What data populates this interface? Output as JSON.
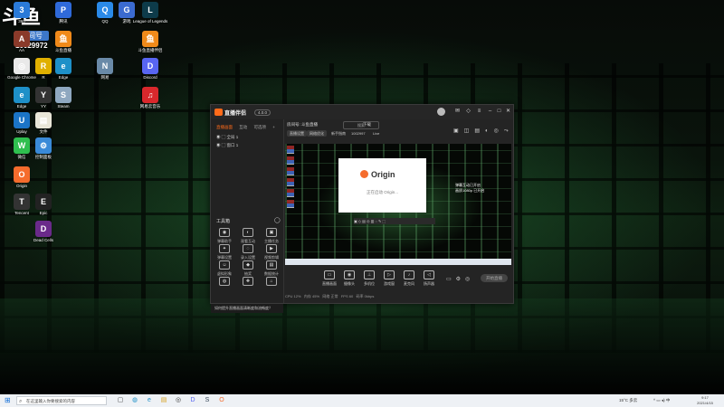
{
  "desktop": {
    "brand": "斗鱼",
    "douyu_badge": {
      "tag": "房间号",
      "number": "10029972"
    },
    "icons": [
      {
        "label": "360",
        "color": "#2a7ad8",
        "glyph": "3"
      },
      {
        "label": "腾讯",
        "color": "#2f6ad9",
        "glyph": "P"
      },
      {
        "label": "QQ",
        "color": "#2a8ae8",
        "glyph": "Q"
      },
      {
        "label": "游戏",
        "color": "#3b6bd0",
        "glyph": "G"
      },
      {
        "label": "League of Legends",
        "color": "#0d3b4a",
        "glyph": "L"
      },
      {
        "label": "AA",
        "color": "#8a3a2a",
        "glyph": "A"
      },
      {
        "label": "斗鱼直播",
        "color": "#f08a1a",
        "glyph": "鱼"
      },
      {
        "label": "Google Chrome",
        "color": "#e9e9e9",
        "glyph": "◎"
      },
      {
        "label": "Edge",
        "color": "#1e90c8",
        "glyph": "e"
      },
      {
        "label": "R",
        "color": "#e0b000",
        "glyph": "R"
      },
      {
        "label": "网易",
        "color": "#6a8aa8",
        "glyph": "N"
      },
      {
        "label": "斗鱼直播伴侣",
        "color": "#f08a1a",
        "glyph": "鱼"
      },
      {
        "label": "Discord",
        "color": "#5865f2",
        "glyph": "D"
      },
      {
        "label": "Edge",
        "color": "#1e90c8",
        "glyph": "e"
      },
      {
        "label": "Steam",
        "color": "#8fa8c0",
        "glyph": "S"
      },
      {
        "label": "YY",
        "color": "#333",
        "glyph": "Y"
      },
      {
        "label": "网易云音乐",
        "color": "#d9282c",
        "glyph": "♫"
      },
      {
        "label": "Uplay",
        "color": "#1b74c7",
        "glyph": "U"
      },
      {
        "label": "文件",
        "color": "#e9e6d8",
        "glyph": "▤"
      },
      {
        "label": "微信",
        "color": "#2fbf4f",
        "glyph": "W"
      },
      {
        "label": "控制面板",
        "color": "#3a8ad8",
        "glyph": "⚙"
      },
      {
        "label": "Origin",
        "color": "#f56c2d",
        "glyph": "O"
      },
      {
        "label": "Tencent",
        "color": "#333",
        "glyph": "T"
      },
      {
        "label": "Epic",
        "color": "#222",
        "glyph": "E"
      },
      {
        "label": "Dead Cells",
        "color": "#6a2a8a",
        "glyph": "D"
      }
    ]
  },
  "app": {
    "title": "直播伴侣",
    "version": "4.0.0",
    "tabs": [
      "直播画面",
      "互动",
      "可选项"
    ],
    "scenes": [
      "全局 1",
      "窗口 1"
    ],
    "tools_title": "工具箱",
    "tools": [
      {
        "label": "弹幕助手",
        "glyph": "◉"
      },
      {
        "label": "观看互动",
        "glyph": "◐"
      },
      {
        "label": "主播任务",
        "glyph": "▣"
      },
      {
        "label": "弹幕设置",
        "glyph": "✦"
      },
      {
        "label": "录入设置",
        "glyph": "◌"
      },
      {
        "label": "视频剪辑",
        "glyph": "▶"
      },
      {
        "label": "虚拟形象",
        "glyph": "☺"
      },
      {
        "label": "抽奖",
        "glyph": "◆"
      },
      {
        "label": "数据统计",
        "glyph": "▤"
      },
      {
        "label": "",
        "glyph": "◍"
      },
      {
        "label": "",
        "glyph": "✚"
      },
      {
        "label": "",
        "glyph": "⌂"
      }
    ],
    "notice": "如何提升直播画面清晰度和流畅度？",
    "top_row": {
      "left": "房间号: 斗鱼直播",
      "search": "搜索",
      "room_label": "下载"
    },
    "pills": [
      "直播设置",
      "网络优化",
      "新手指南",
      "1002997",
      "Live"
    ],
    "overlay_info": [
      "弹幕互动已开启",
      "画质1080p 已开启"
    ],
    "origin_dialog": {
      "brand": "Origin",
      "loading": "正在启动 Origin..."
    },
    "mini_toolbar": "▣ ◇ ▤ ◎ ▥ ◌ ✎ ⬚",
    "bottom_buttons": [
      {
        "label": "直播画面",
        "glyph": "▭"
      },
      {
        "label": "摄像头",
        "glyph": "◉"
      },
      {
        "label": "多机位",
        "glyph": "⊥"
      },
      {
        "label": "游戏窗",
        "glyph": "▷"
      },
      {
        "label": "麦克风",
        "glyph": "♪"
      },
      {
        "label": "扬声器",
        "glyph": "◁"
      }
    ],
    "live_button": "开始直播",
    "status": [
      "CPU 12%",
      "内存 45%",
      "网络 正常",
      "FPS 60",
      "码率 0kbps"
    ]
  },
  "taskbar": {
    "search_placeholder": "在这里输入你要搜索的内容",
    "apps": [
      "▢",
      "◍",
      "e",
      "▤",
      "◎",
      "D",
      "S",
      "O"
    ],
    "weather": "15°C 多云",
    "tray": "^ ▭ ◂) 中",
    "time": "9:17",
    "date": "2021/4/15"
  }
}
